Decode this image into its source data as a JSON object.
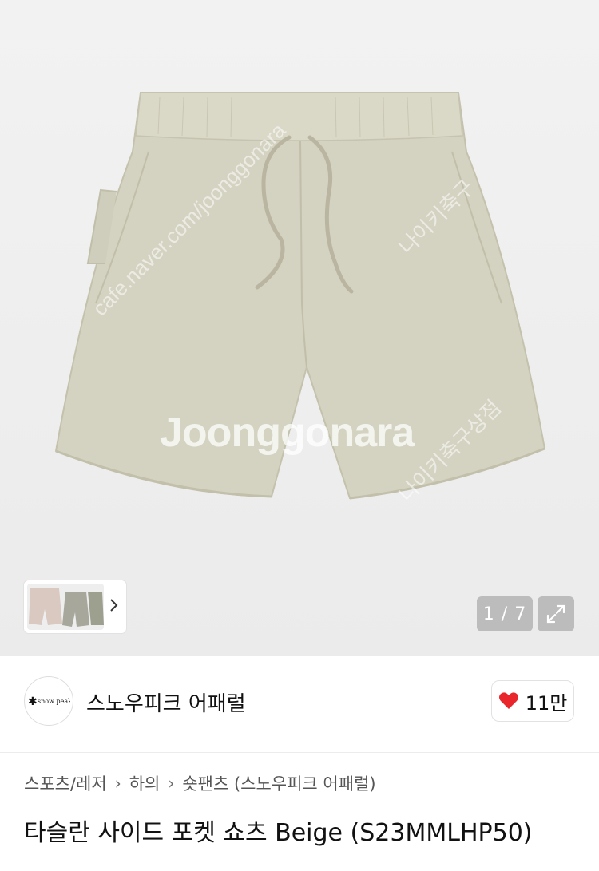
{
  "image": {
    "watermark": "Joonggonara",
    "diag_text_1": "cafe.naver.com/joonggonara",
    "diag_text_2": "나이키축구",
    "diag_text_3": "나이키축구상점",
    "counter": "1 / 7",
    "product_colors": {
      "fabric": "#d4d2c0",
      "shadow": "#c2c0ab",
      "string": "#bdb9a6"
    }
  },
  "thumbnails": {
    "more_icon": "chevron-right-icon"
  },
  "store": {
    "logo_text": "snow peak",
    "name": "스노우피크 어패럴",
    "like_count": "11만",
    "like_color": "#e8262b"
  },
  "breadcrumb": {
    "items": [
      "스포츠/레저",
      "하의",
      "숏팬츠 (스노우피크 어패럴)"
    ]
  },
  "product": {
    "title": "타슬란 사이드 포켓 쇼츠 Beige (S23MMLHP50)"
  }
}
